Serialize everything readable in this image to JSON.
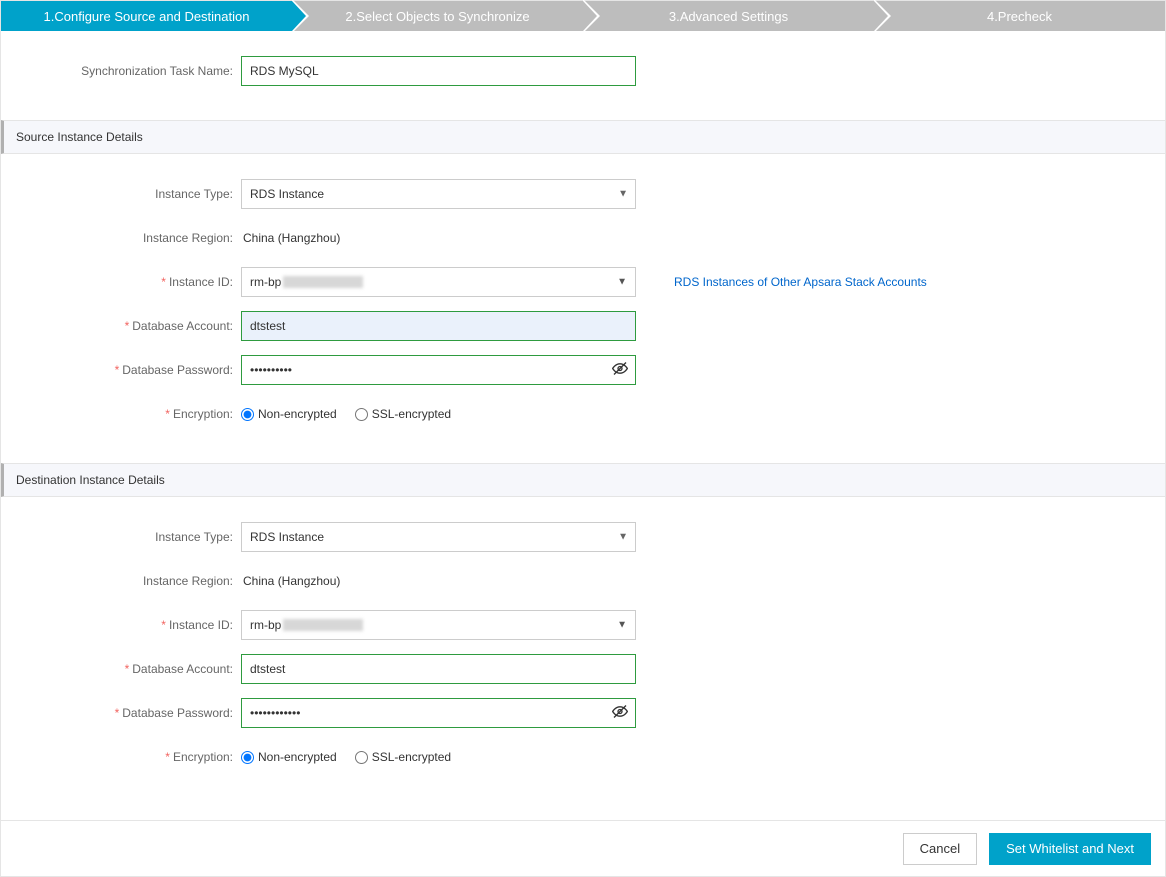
{
  "steps": {
    "s1": "1.Configure Source and Destination",
    "s2": "2.Select Objects to Synchronize",
    "s3": "3.Advanced Settings",
    "s4": "4.Precheck"
  },
  "labels": {
    "taskName": "Synchronization Task Name:",
    "instanceType": "Instance Type:",
    "instanceRegion": "Instance Region:",
    "instanceId": "Instance ID:",
    "dbAccount": "Database Account:",
    "dbPassword": "Database Password:",
    "encryption": "Encryption:"
  },
  "sections": {
    "source": "Source Instance Details",
    "destination": "Destination Instance Details"
  },
  "task": {
    "name": "RDS MySQL"
  },
  "source": {
    "instanceTypeOptions": [
      "RDS Instance"
    ],
    "instanceTypeSelected": "RDS Instance",
    "region": "China (Hangzhou)",
    "instanceIdPrefix": "rm-bp",
    "account": "dtstest",
    "passwordMasked": "••••••••••",
    "encryption": {
      "nonEncrypted": "Non-encrypted",
      "ssl": "SSL-encrypted",
      "selected": "non"
    },
    "otherAccountLink": "RDS Instances of Other Apsara Stack Accounts"
  },
  "destination": {
    "instanceTypeOptions": [
      "RDS Instance"
    ],
    "instanceTypeSelected": "RDS Instance",
    "region": "China (Hangzhou)",
    "instanceIdPrefix": "rm-bp",
    "account": "dtstest",
    "passwordMasked": "••••••••••••",
    "encryption": {
      "nonEncrypted": "Non-encrypted",
      "ssl": "SSL-encrypted",
      "selected": "non"
    }
  },
  "footer": {
    "cancel": "Cancel",
    "next": "Set Whitelist and Next"
  }
}
